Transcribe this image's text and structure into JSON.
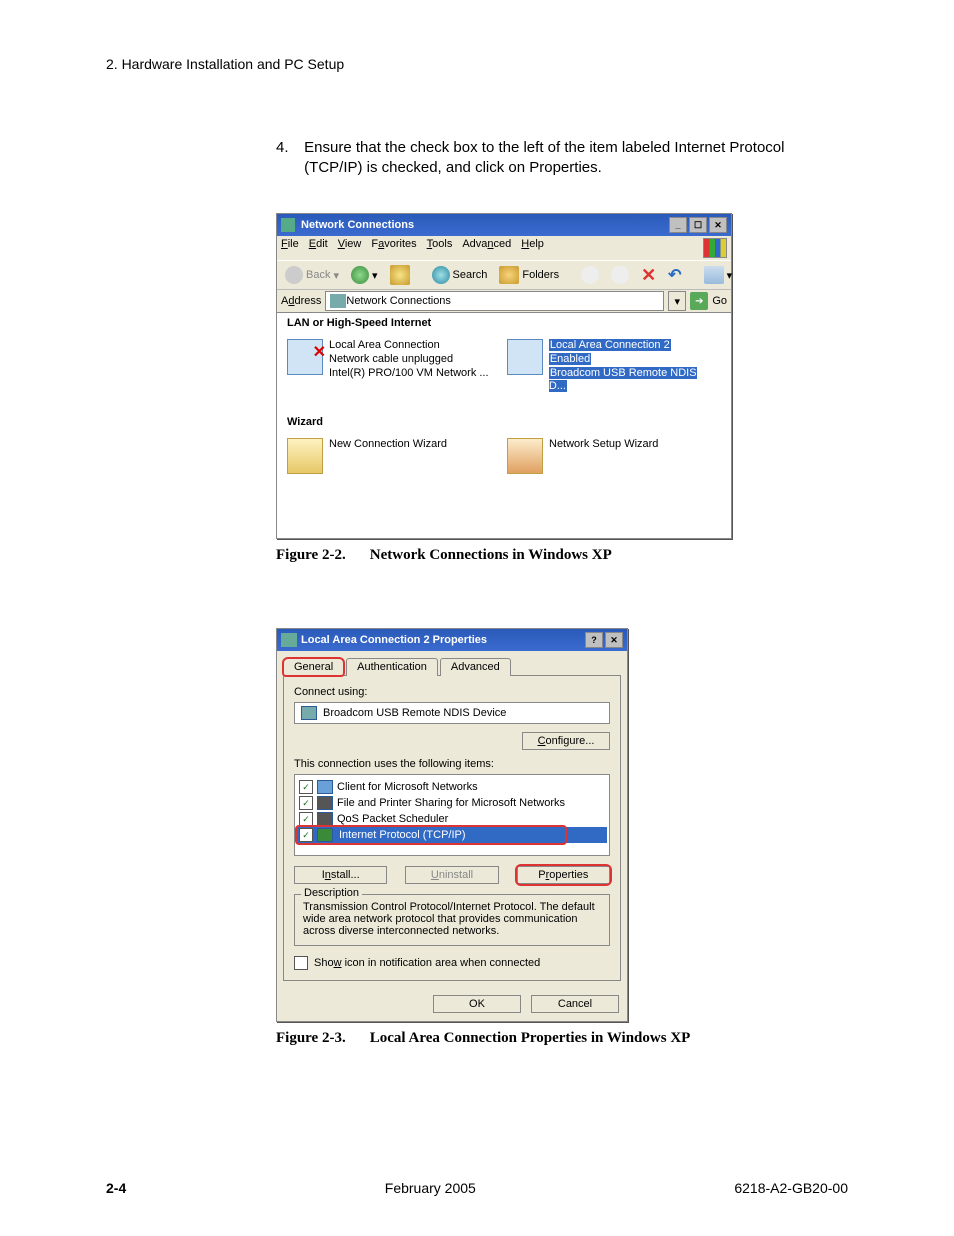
{
  "header": {
    "chapter_line": "2. Hardware Installation and PC Setup"
  },
  "step": {
    "number": "4.",
    "text_a": "Ensure that the check box to the left of the item labeled Internet Protocol",
    "text_b": "(TCP/IP) is checked, and click on Properties."
  },
  "fig1": {
    "title": "Network Connections",
    "menus": {
      "file": "File",
      "edit": "Edit",
      "view": "View",
      "favorites": "Favorites",
      "tools": "Tools",
      "advanced": "Advanced",
      "help": "Help"
    },
    "toolbar": {
      "back": "Back",
      "search": "Search",
      "folders": "Folders"
    },
    "address_label": "Address",
    "address_value": "Network Connections",
    "go_label": "Go",
    "group_lan": "LAN or High-Speed Internet",
    "lan1": {
      "name": "Local Area Connection",
      "status": "Network cable unplugged",
      "device": "Intel(R) PRO/100 VM Network ..."
    },
    "lan2": {
      "name": "Local Area Connection 2",
      "status": "Enabled",
      "device": "Broadcom USB Remote NDIS D..."
    },
    "group_wizard": "Wizard",
    "wiz1": "New Connection Wizard",
    "wiz2": "Network Setup Wizard",
    "caption_num": "Figure 2-2.",
    "caption_text": "Network Connections in Windows XP"
  },
  "fig2": {
    "title": "Local Area Connection 2 Properties",
    "tabs": {
      "general": "General",
      "auth": "Authentication",
      "adv": "Advanced"
    },
    "connect_using_label": "Connect using:",
    "adapter": "Broadcom USB Remote NDIS Device",
    "configure_btn": "Configure...",
    "items_label": "This connection uses the following items:",
    "items": {
      "a": "Client for Microsoft Networks",
      "b": "File and Printer Sharing for Microsoft Networks",
      "c": "QoS Packet Scheduler",
      "d": "Internet Protocol (TCP/IP)"
    },
    "install_btn": "Install...",
    "uninstall_btn": "Uninstall",
    "properties_btn": "Properties",
    "desc_label": "Description",
    "desc_text_a": "Transmission Control Protocol/Internet Protocol. The default",
    "desc_text_b": "wide area network protocol that provides communication",
    "desc_text_c": "across diverse interconnected networks.",
    "show_icon": "Show icon in notification area when connected",
    "ok_btn": "OK",
    "cancel_btn": "Cancel",
    "caption_num": "Figure 2-3.",
    "caption_text": "Local Area Connection Properties in Windows XP"
  },
  "footer": {
    "page": "2-4",
    "date": "February 2005",
    "doc": "6218-A2-GB20-00"
  }
}
